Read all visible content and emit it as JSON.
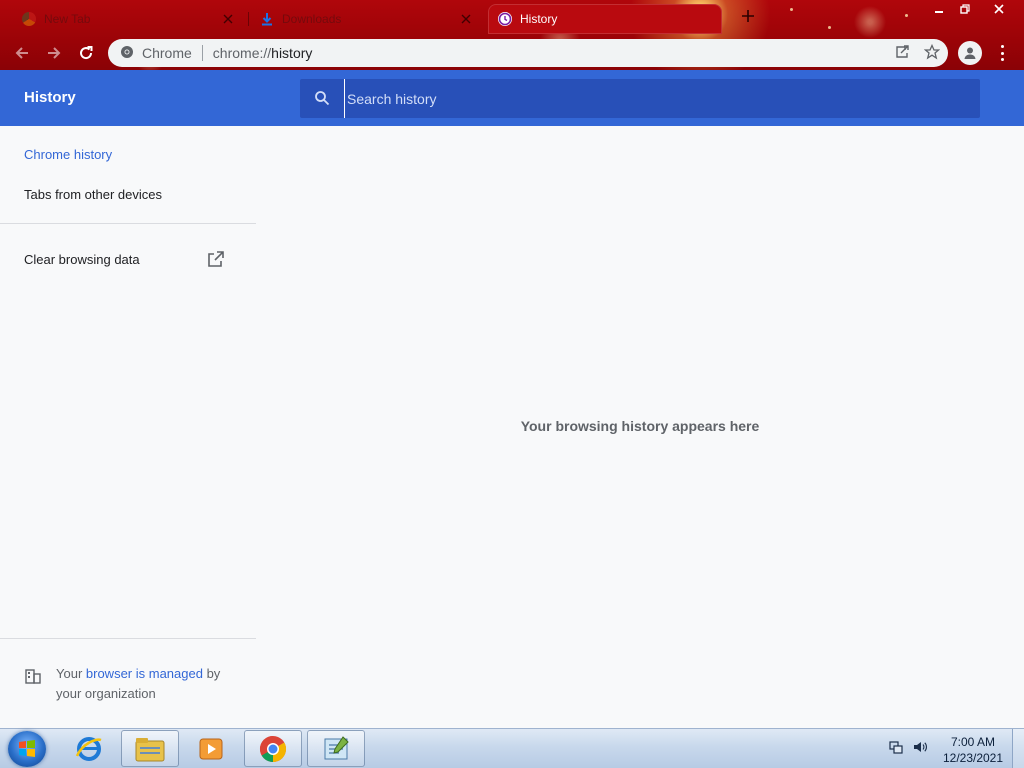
{
  "browser": {
    "tabs": [
      {
        "title": "New Tab",
        "favicon": "chrome-favicon-icon",
        "active": false
      },
      {
        "title": "Downloads",
        "favicon": "download-favicon-icon",
        "active": false
      },
      {
        "title": "History",
        "favicon": "history-favicon-icon",
        "active": true
      }
    ],
    "omnibox": {
      "site_label": "Chrome",
      "url_prefix": "chrome://",
      "url_path": "history"
    }
  },
  "page": {
    "title": "History",
    "search": {
      "placeholder": "Search history"
    },
    "sidebar": {
      "items": [
        {
          "label": "Chrome history",
          "selected": true
        },
        {
          "label": "Tabs from other devices",
          "selected": false
        }
      ],
      "clear_data_label": "Clear browsing data",
      "managed": {
        "prefix": "Your ",
        "link": "browser is managed",
        "suffix_1": " by",
        "suffix_2": "your organization"
      }
    },
    "empty_message": "Your browsing history appears here"
  },
  "taskbar": {
    "apps": [
      "internet-explorer-icon",
      "file-explorer-icon",
      "media-player-icon",
      "chrome-icon",
      "notepad-icon"
    ],
    "clock": {
      "time": "7:00 AM",
      "date": "12/23/2021"
    }
  },
  "colors": {
    "header_blue": "#3367d6",
    "search_bg": "#2850b8",
    "frame_red": "#b0060b",
    "link_blue": "#3367d6"
  }
}
